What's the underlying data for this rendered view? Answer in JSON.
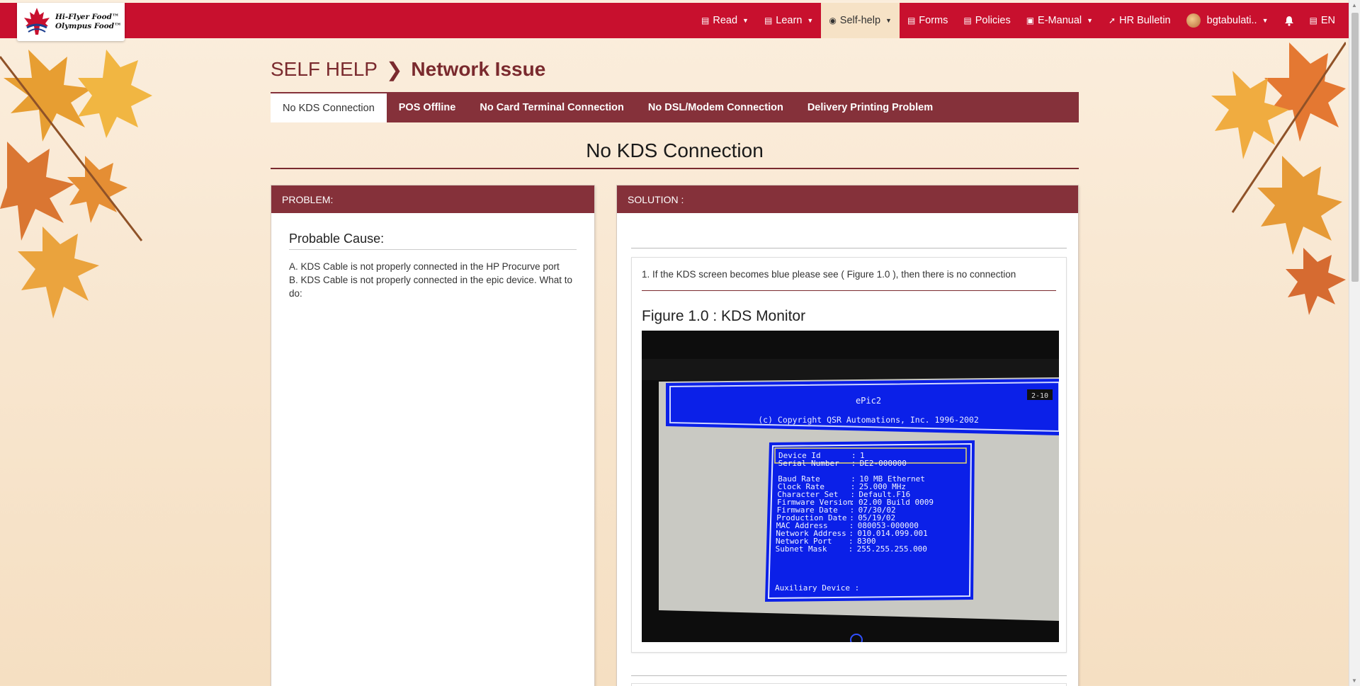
{
  "brand": {
    "line1": "Hi-Flyer Food™",
    "line2": "Olympus Food™"
  },
  "nav": [
    {
      "label": "Read",
      "icon": "newspaper-icon",
      "caret": true
    },
    {
      "label": "Learn",
      "icon": "book-icon",
      "caret": true
    },
    {
      "label": "Self-help",
      "icon": "lifebuoy-icon",
      "caret": true,
      "active": true
    },
    {
      "label": "Forms",
      "icon": "form-icon",
      "caret": false
    },
    {
      "label": "Policies",
      "icon": "policy-icon",
      "caret": false
    },
    {
      "label": "E-Manual",
      "icon": "manual-icon",
      "caret": true
    },
    {
      "label": "HR Bulletin",
      "icon": "pin-icon",
      "caret": false
    }
  ],
  "user": {
    "name": "bgtabulati..",
    "language": "EN"
  },
  "breadcrumb": {
    "parent": "SELF HELP",
    "current": "Network Issue"
  },
  "tabs": [
    {
      "label": "No KDS Connection",
      "active": true
    },
    {
      "label": "POS Offline"
    },
    {
      "label": "No Card Terminal Connection"
    },
    {
      "label": "No DSL/Modem Connection"
    },
    {
      "label": "Delivery Printing Problem"
    }
  ],
  "section_title": "No KDS Connection",
  "problem": {
    "header": "PROBLEM:",
    "title": "Probable Cause:",
    "lines": [
      "A. KDS Cable is not properly connected in the HP Procurve port",
      "B. KDS Cable is not properly connected in the epic device. What to do:"
    ]
  },
  "solution": {
    "header": "SOLUTION :",
    "step1": "1. If the KDS screen becomes blue please see ( Figure 1.0 ), then there is no connection",
    "figure_title": "Figure 1.0 : KDS Monitor",
    "screen": {
      "title": "ePic2",
      "copyright": "(c) Copyright QSR Automations, Inc. 1996-2002",
      "corner": "2-10",
      "rows": [
        [
          "Device Id",
          "1"
        ],
        [
          "Serial Number",
          "DE2-000000"
        ],
        [
          "Baud Rate",
          "10 MB Ethernet"
        ],
        [
          "Clock Rate",
          "25.000 MHz"
        ],
        [
          "Character Set",
          "Default.F16"
        ],
        [
          "Firmware Version",
          "02.00 Build 0009"
        ],
        [
          "Firmware Date",
          "07/30/02"
        ],
        [
          "Production Date",
          "05/19/02"
        ],
        [
          "MAC Address",
          "080053-000000"
        ],
        [
          "Network Address",
          "010.014.099.001"
        ],
        [
          "Network Port",
          "8300"
        ],
        [
          "Subnet Mask",
          "255.255.255.000"
        ]
      ],
      "aux": "Auxiliary Device :"
    }
  },
  "colors": {
    "nav_red": "#c8102e",
    "maroon": "#85313a",
    "title_maroon": "#7a2a2e",
    "kds_blue": "#0a1cf0"
  }
}
